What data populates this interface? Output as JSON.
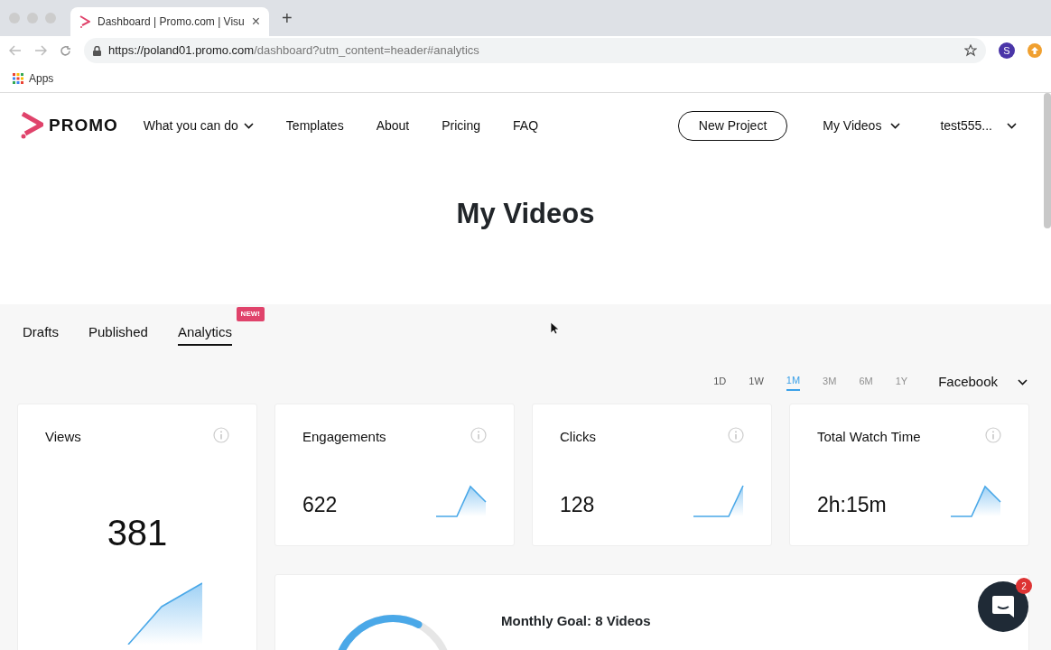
{
  "browser": {
    "tab_title": "Dashboard | Promo.com | Visu",
    "close": "×",
    "new_tab": "+",
    "url_host": "https://poland01.promo.com",
    "url_path": "/dashboard?utm_content=header#analytics",
    "profile": "S",
    "bookmarks": [
      "Apps"
    ]
  },
  "header": {
    "logo": "PROMO",
    "nav": [
      {
        "label": "What you can do",
        "dropdown": true
      },
      {
        "label": "Templates",
        "dropdown": false
      },
      {
        "label": "About",
        "dropdown": false
      },
      {
        "label": "Pricing",
        "dropdown": false
      },
      {
        "label": "FAQ",
        "dropdown": false
      }
    ],
    "new_project": "New Project",
    "right_menus": [
      "My Videos",
      "test555..."
    ]
  },
  "title": "My Videos",
  "tabs": [
    {
      "label": "Drafts",
      "selected": false
    },
    {
      "label": "Published",
      "selected": false
    },
    {
      "label": "Analytics",
      "selected": true,
      "badge": "NEW!"
    }
  ],
  "ranges": [
    {
      "label": "1D",
      "selected": false,
      "disabled": false
    },
    {
      "label": "1W",
      "selected": false,
      "disabled": false
    },
    {
      "label": "1M",
      "selected": true,
      "disabled": false
    },
    {
      "label": "3M",
      "selected": false,
      "disabled": true
    },
    {
      "label": "6M",
      "selected": false,
      "disabled": true
    },
    {
      "label": "1Y",
      "selected": false,
      "disabled": true
    }
  ],
  "platform": "Facebook",
  "stats": [
    {
      "title": "Views",
      "value": "381",
      "kind": "large"
    },
    {
      "title": "Engagements",
      "value": "622",
      "kind": "peak"
    },
    {
      "title": "Clicks",
      "value": "128",
      "kind": "rise"
    },
    {
      "title": "Total Watch Time",
      "value": "2h:15m",
      "kind": "peak"
    }
  ],
  "goal": {
    "title": "Monthly Goal: 8 Videos"
  },
  "chat": {
    "badge": "2"
  }
}
